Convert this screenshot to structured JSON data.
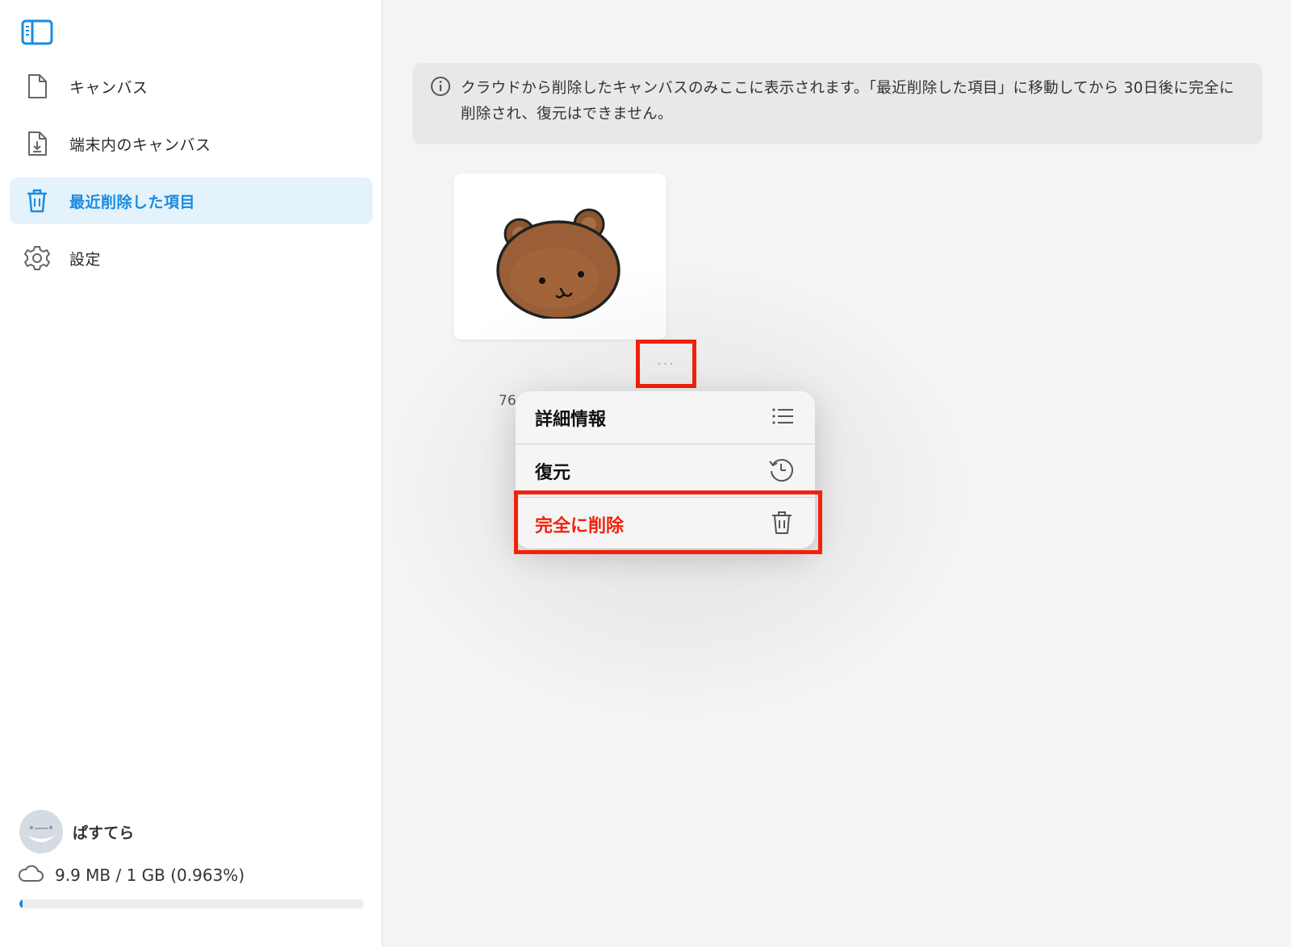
{
  "sidebar": {
    "items": [
      {
        "label": "キャンバス",
        "icon": "document-icon"
      },
      {
        "label": "端末内のキャンバス",
        "icon": "document-download-icon"
      },
      {
        "label": "最近削除した項目",
        "icon": "trash-icon",
        "active": true
      },
      {
        "label": "設定",
        "icon": "gear-icon"
      }
    ],
    "account": {
      "name": "ぱすてら"
    },
    "storage": {
      "text": "9.9 MB / 1 GB (0.963%)",
      "used_fraction": 0.00963
    }
  },
  "notice": {
    "text": "クラウドから削除したキャンバスのみここに表示されます。「最近削除した項目」に移動してから 30日後に完全に削除され、復元はできません。"
  },
  "canvas_item": {
    "more_label": "···",
    "size_partial": "76"
  },
  "context_menu": {
    "items": [
      {
        "label": "詳細情報",
        "icon": "list-icon"
      },
      {
        "label": "復元",
        "icon": "history-icon"
      },
      {
        "label": "完全に削除",
        "icon": "trash-icon",
        "destructive": true
      }
    ]
  },
  "colors": {
    "accent": "#1a8be0",
    "active_bg": "#e4f2fc",
    "destructive": "#f0220c",
    "highlight": "#f0220c"
  }
}
